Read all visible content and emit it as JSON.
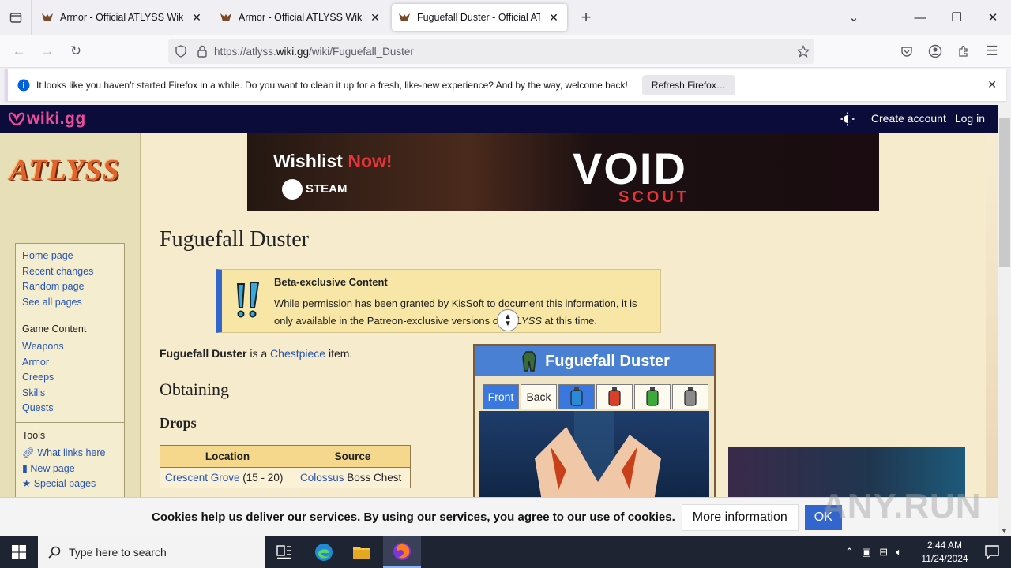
{
  "browser": {
    "tabs": [
      {
        "title": "Armor - Official ATLYSS Wiki",
        "active": false
      },
      {
        "title": "Armor - Official ATLYSS Wiki",
        "active": false
      },
      {
        "title": "Fuguefall Duster - Official ATLYSS Wiki",
        "active": true
      }
    ],
    "url_prefix": "https://atlyss.",
    "url_domain": "wiki.gg",
    "url_path": "/wiki/Fuguefall_Duster"
  },
  "notification": {
    "message": "It looks like you haven’t started Firefox in a while. Do you want to clean it up for a fresh, like-new experience? And by the way, welcome back!",
    "button": "Refresh Firefox…"
  },
  "site_header": {
    "logo": "wiki.gg",
    "create_account": "Create account",
    "log_in": "Log in"
  },
  "sidebar": {
    "logo_text": "ATLYSS",
    "nav": [
      "Home page",
      "Recent changes",
      "Random page",
      "See all pages"
    ],
    "game_content_heading": "Game Content",
    "game_content": [
      "Weapons",
      "Armor",
      "Creeps",
      "Skills",
      "Quests"
    ],
    "tools_heading": "Tools",
    "tools": [
      "What links here",
      "New page",
      "Special pages"
    ]
  },
  "banner": {
    "wishlist": "Wishlist",
    "now": "Now!",
    "platform": "STEAM",
    "game_logo": "VOID",
    "game_sub": "SCOUT"
  },
  "article": {
    "title": "Fuguefall Duster",
    "notice_heading": "Beta-exclusive Content",
    "notice_text_1": "While permission has been granted by KisSoft to document this information, it is only available in the Patreon-exclusive versions of ",
    "notice_game": "ATLYSS",
    "notice_text_2": " at this time.",
    "intro_name": "Fuguefall Duster",
    "intro_mid": " is a ",
    "intro_link": "Chestpiece",
    "intro_end": " item.",
    "obtaining": "Obtaining",
    "drops": "Drops",
    "table_headers": [
      "Location",
      "Source"
    ],
    "table_rows": [
      {
        "location_link": "Crescent Grove",
        "location_extra": " (15 - 20)",
        "source_link": "Colossus",
        "source_extra": " Boss Chest"
      }
    ]
  },
  "infobox": {
    "title": "Fuguefall Duster",
    "tabs": [
      "Front",
      "Back"
    ],
    "dye_colors": [
      "#2a8ad8",
      "#d8402a",
      "#3aaa3a",
      "#8a8a8a"
    ]
  },
  "cookie_bar": {
    "text": "Cookies help us deliver our services. By using our services, you agree to our use of cookies.",
    "more": "More information",
    "ok": "OK"
  },
  "taskbar": {
    "search_placeholder": "Type here to search",
    "time": "2:44 AM",
    "date": "11/24/2024"
  },
  "watermark": "ANY.RUN"
}
